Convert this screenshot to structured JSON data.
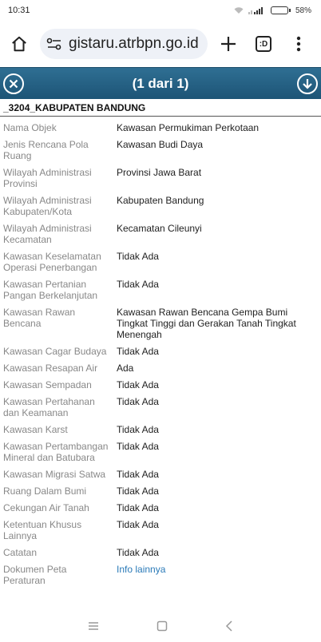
{
  "status": {
    "time": "10:31",
    "battery": "58%",
    "battery_level": 0.58
  },
  "browser": {
    "url": "gistaru.atrbpn.go.id",
    "tab_count": ":D"
  },
  "popup": {
    "title": "(1 dari 1)",
    "layer": "_3204_KABUPATEN BANDUNG",
    "rows": [
      {
        "key": "Nama Objek",
        "value": "Kawasan Permukiman Perkotaan"
      },
      {
        "key": "Jenis Rencana Pola Ruang",
        "value": "Kawasan Budi Daya"
      },
      {
        "key": "Wilayah Administrasi Provinsi",
        "value": "Provinsi Jawa Barat"
      },
      {
        "key": "Wilayah Administrasi Kabupaten/Kota",
        "value": "Kabupaten Bandung"
      },
      {
        "key": "Wilayah Administrasi Kecamatan",
        "value": "Kecamatan Cileunyi"
      },
      {
        "key": "Kawasan Keselamatan Operasi Penerbangan",
        "value": "Tidak Ada"
      },
      {
        "key": "Kawasan Pertanian Pangan Berkelanjutan",
        "value": "Tidak Ada"
      },
      {
        "key": "Kawasan Rawan Bencana",
        "value": "Kawasan Rawan Bencana Gempa Bumi Tingkat Tinggi dan Gerakan Tanah Tingkat Menengah"
      },
      {
        "key": "Kawasan Cagar Budaya",
        "value": "Tidak Ada"
      },
      {
        "key": "Kawasan Resapan Air",
        "value": "Ada"
      },
      {
        "key": "Kawasan Sempadan",
        "value": "Tidak Ada"
      },
      {
        "key": "Kawasan Pertahanan dan Keamanan",
        "value": "Tidak Ada"
      },
      {
        "key": "Kawasan Karst",
        "value": "Tidak Ada"
      },
      {
        "key": "Kawasan Pertambangan Mineral dan Batubara",
        "value": "Tidak Ada"
      },
      {
        "key": "Kawasan Migrasi Satwa",
        "value": "Tidak Ada"
      },
      {
        "key": "Ruang Dalam Bumi",
        "value": "Tidak Ada"
      },
      {
        "key": "Cekungan Air Tanah",
        "value": "Tidak Ada"
      },
      {
        "key": "Ketentuan Khusus Lainnya",
        "value": "Tidak Ada"
      },
      {
        "key": "Catatan",
        "value": "Tidak Ada"
      },
      {
        "key": "Dokumen Peta Peraturan",
        "value": "Info lainnya",
        "link": true
      }
    ]
  },
  "icons": {
    "home": "home-icon",
    "site_settings": "site-settings-icon",
    "new_tab": "plus-icon",
    "menu": "more-vert-icon",
    "close": "close-icon",
    "next": "arrow-down-icon",
    "nav_menu": "menu-icon",
    "nav_home": "square-icon",
    "nav_back": "back-icon"
  },
  "colors": {
    "header": "#1d5476",
    "link": "#2a7ab8"
  }
}
